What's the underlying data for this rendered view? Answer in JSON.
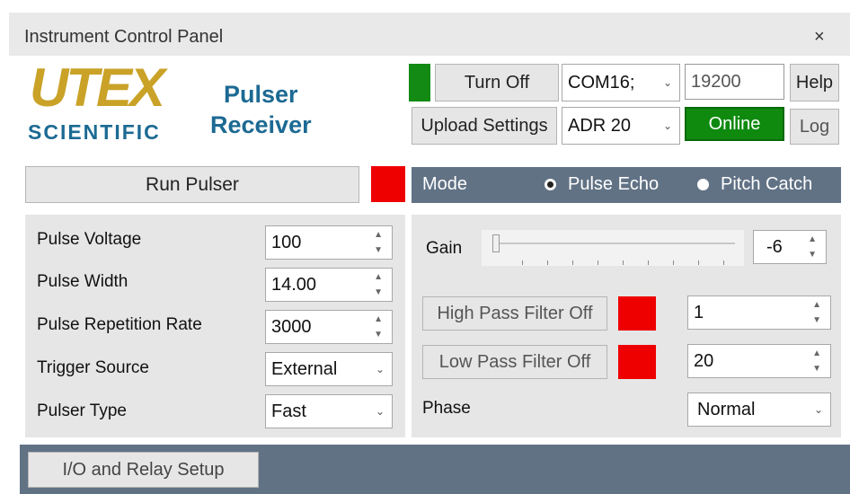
{
  "window": {
    "title": "Instrument Control Panel",
    "close": "×"
  },
  "brand": {
    "logo_text": "UTEX",
    "logo_subtext": "SCIENTIFIC",
    "product_line1": "Pulser",
    "product_line2": "Receiver"
  },
  "header": {
    "turn_off": "Turn Off",
    "com_port": "COM16;",
    "baud": "19200",
    "help": "Help",
    "upload": "Upload Settings",
    "address": "ADR 20",
    "status": "Online",
    "log": "Log"
  },
  "run": {
    "label": "Run Pulser",
    "indicator_color": "#ee0000"
  },
  "mode": {
    "label": "Mode",
    "options": [
      "Pulse Echo",
      "Pitch Catch"
    ],
    "selected": "Pulse Echo"
  },
  "pulser": {
    "voltage_label": "Pulse Voltage",
    "voltage": "100",
    "width_label": "Pulse Width",
    "width": "14.00",
    "rate_label": "Pulse Repetition Rate",
    "rate": "3000",
    "trigger_label": "Trigger Source",
    "trigger": "External",
    "type_label": "Pulser Type",
    "type": "Fast"
  },
  "receiver": {
    "gain_label": "Gain",
    "gain": "-6",
    "gain_slider_fraction": 0.0,
    "hpf_label": "High Pass Filter Off",
    "hpf_value": "1",
    "lpf_label": "Low Pass Filter Off",
    "lpf_value": "20",
    "phase_label": "Phase",
    "phase": "Normal"
  },
  "footer": {
    "io_button": "I/O and Relay Setup"
  },
  "colors": {
    "accent_green": "#0f8a0f",
    "indicator_red": "#ee0000",
    "bar_slate": "#617285",
    "brand_blue": "#1c6a93",
    "brand_gold": "#c9a227"
  }
}
